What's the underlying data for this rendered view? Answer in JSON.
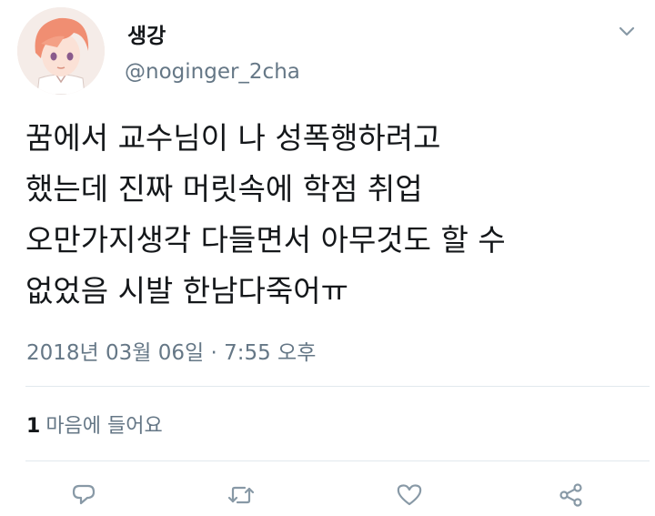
{
  "user": {
    "display_name": "생강",
    "handle": "@noginger_2cha"
  },
  "tweet": {
    "lines": [
      "꿈에서 교수님이 나 성폭행하려고",
      "했는데 진짜 머릿속에 학점 취업",
      "오만가지생각 다들면서 아무것도 할 수",
      "없었음 시발 한남다죽어ㅠ"
    ],
    "timestamp": "2018년 03월 06일 · 7:55 오후"
  },
  "stats": {
    "like_count": "1",
    "like_label": "마음에 들어요"
  },
  "icons": {
    "avatar": "avatar-illustration",
    "menu": "chevron-down-icon",
    "actions": [
      "reply-icon",
      "retweet-icon",
      "like-icon",
      "share-icon"
    ]
  },
  "colors": {
    "text_primary": "#14171a",
    "text_secondary": "#657786",
    "icon": "#8899a6",
    "divider": "#e1e8ed"
  }
}
